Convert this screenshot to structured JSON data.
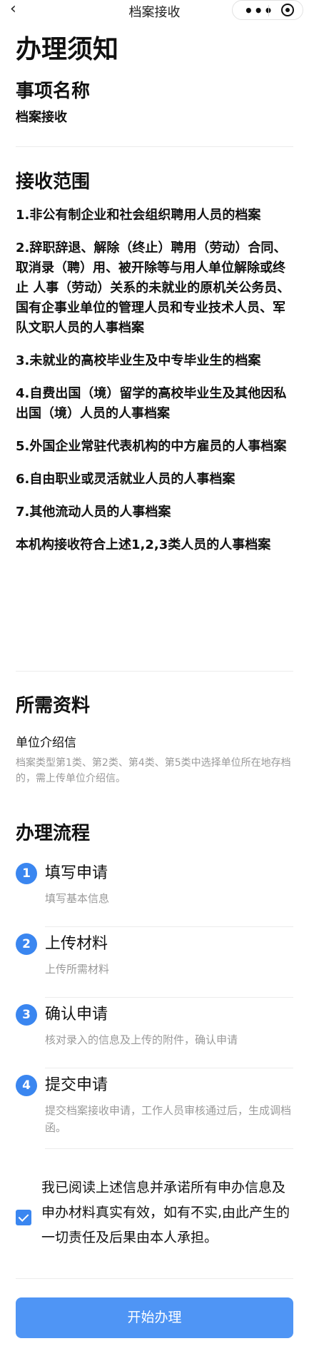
{
  "navbar": {
    "back_icon": "chevron-left-icon",
    "title": "档案接收",
    "more_icon": "more-icon",
    "close_icon": "target-icon"
  },
  "page": {
    "title": "办理须知"
  },
  "item_name": {
    "heading": "事项名称",
    "value": "档案接收"
  },
  "scope": {
    "heading": "接收范围",
    "items": [
      "1.非公有制企业和社会组织聘用人员的档案",
      "2.辞职辞退、解除（终止）聘用（劳动）合同、取消录（聘）用、被开除等与用人单位解除或终止 人事（劳动）关系的未就业的原机关公务员、国有企事业单位的管理人员和专业技术人员、军队文职人员的人事档案",
      "3.未就业的高校毕业生及中专毕业生的档案",
      "4.自费出国（境）留学的高校毕业生及其他因私出国（境）人员的人事档案",
      "5.外国企业常驻代表机构的中方雇员的人事档案",
      "6.自由职业或灵活就业人员的人事档案",
      "7.其他流动人员的人事档案",
      "本机构接收符合上述1,2,3类人员的人事档案"
    ]
  },
  "materials": {
    "heading": "所需资料",
    "name": "单位介绍信",
    "description": "档案类型第1类、第2类、第4类、第5类中选择单位所在地存档的，需上传单位介绍信。"
  },
  "process": {
    "heading": "办理流程",
    "steps": [
      {
        "num": "1",
        "title": "填写申请",
        "desc": "填写基本信息"
      },
      {
        "num": "2",
        "title": "上传材料",
        "desc": "上传所需材料"
      },
      {
        "num": "3",
        "title": "确认申请",
        "desc": "核对录入的信息及上传的附件，确认申请"
      },
      {
        "num": "4",
        "title": "提交申请",
        "desc": "提交档案接收申请，工作人员审核通过后，生成调档函。"
      }
    ]
  },
  "agreement": {
    "checked": true,
    "text": "我已阅读上述信息并承诺所有申办信息及申办材料真实有效，如有不实,由此产生的一切责任及后果由本人承担。"
  },
  "start_button": {
    "label": "开始办理",
    "color": "#4f95f5"
  },
  "colors": {
    "accent": "#3a86f0",
    "muted": "#9a9a9a"
  }
}
